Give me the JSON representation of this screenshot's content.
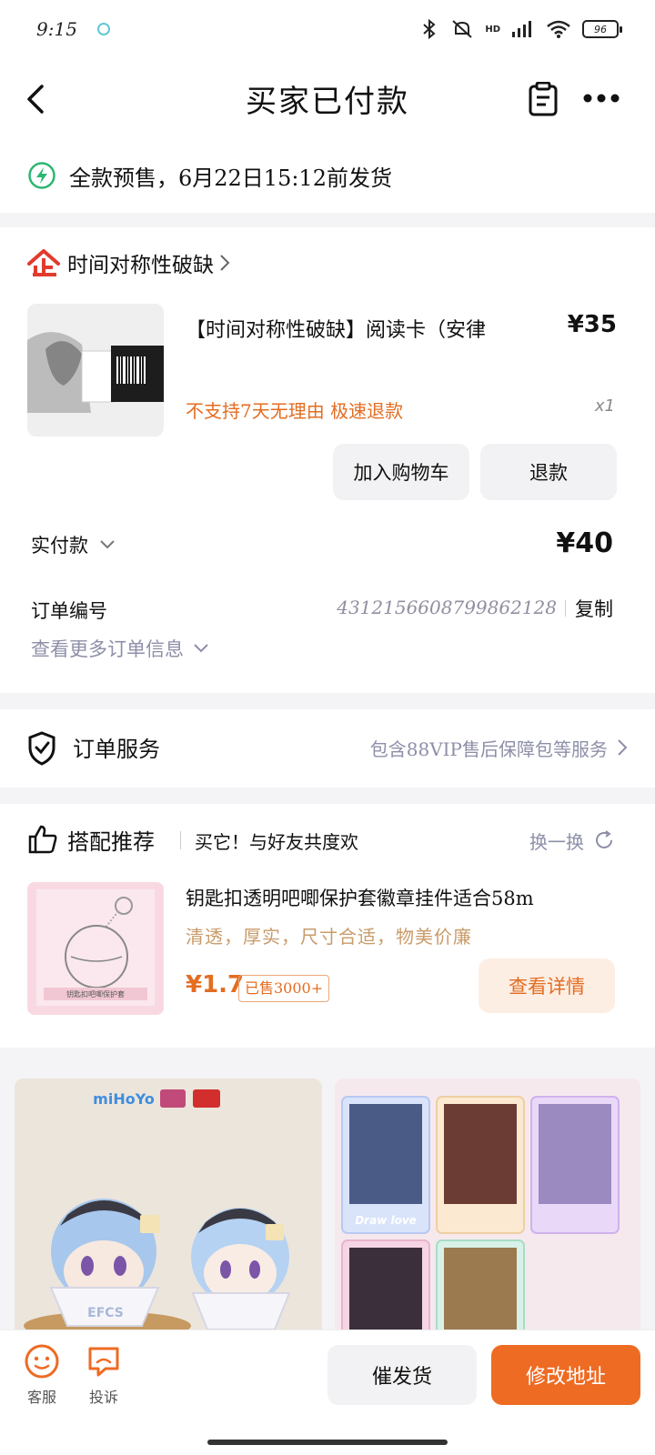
{
  "status_bar": {
    "time": "9:15",
    "hd": "HD",
    "battery": "96"
  },
  "nav": {
    "title": "买家已付款"
  },
  "shipping": {
    "text": "全款预售，6月22日15:12前发货"
  },
  "order": {
    "shop_name": "时间对称性破缺",
    "product_title": "【时间对称性破缺】阅读卡（安律",
    "product_price": "¥35",
    "product_tags": "不支持7天无理由  极速退款",
    "product_qty": "x1",
    "add_cart_label": "加入购物车",
    "refund_label": "退款",
    "paid_label": "实付款",
    "paid_amount": "¥40",
    "order_no_label": "订单编号",
    "order_no": "4312156608799862128",
    "copy_label": "复制",
    "more_info_label": "查看更多订单信息"
  },
  "service": {
    "label": "订单服务",
    "desc": "包含88VIP售后保障包等服务"
  },
  "recommend": {
    "title": "搭配推荐",
    "subtitle": "买它！与好友共度欢",
    "switch_label": "换一换",
    "item_name": "钥匙扣透明吧唧保护套徽章挂件适合58m",
    "item_desc": "清透，厚实，尺寸合适，物美价廉",
    "item_price": "¥1.7",
    "item_sold": "已售3000+",
    "detail_label": "查看详情",
    "item_img_text": "钥匙扣吧唧保护套"
  },
  "feed": {
    "left_brand": "miHoYo",
    "left_figure_text": "EFCS",
    "right_card_text": "Draw love"
  },
  "bottom": {
    "service_label": "客服",
    "complain_label": "投诉",
    "urge_label": "催发货",
    "change_addr_label": "修改地址"
  },
  "colors": {
    "accent": "#ee6b23",
    "price_orange": "#e36d21",
    "muted": "#8d8fa8",
    "shop_red": "#e23b2e",
    "lightning_green": "#2bb673"
  },
  "icons": {
    "back": "chevron-left-icon",
    "order_list": "clipboard-icon",
    "more": "more-dots-icon",
    "lightning": "lightning-icon",
    "shop": "shop-logo-icon",
    "shield": "shield-check-icon",
    "thumb": "thumbs-up-icon",
    "refresh": "refresh-icon",
    "service": "customer-service-icon",
    "complain": "complaint-icon"
  }
}
